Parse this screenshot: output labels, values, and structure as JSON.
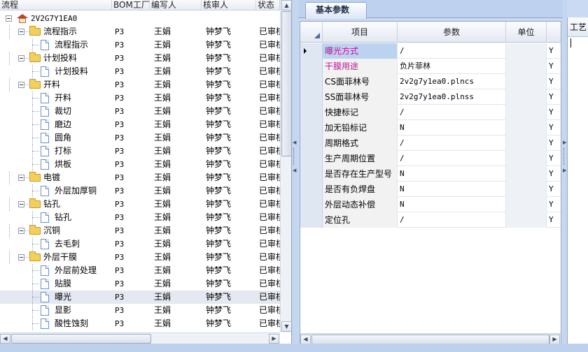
{
  "tree": {
    "columns": [
      "流程",
      "BOM工厂",
      "编写人",
      "核审人",
      "状态"
    ],
    "rows": [
      {
        "label": "2V2G7Y1EA0",
        "bom": "",
        "editor": "",
        "reviewer": "",
        "status": "",
        "level": 0,
        "icon": "house-icon"
      },
      {
        "label": "流程指示",
        "bom": "P3",
        "editor": "王娟",
        "reviewer": "钟梦飞",
        "status": "已审核",
        "level": 1,
        "icon": "folder-icon"
      },
      {
        "label": "流程指示",
        "bom": "P3",
        "editor": "王娟",
        "reviewer": "钟梦飞",
        "status": "已审核",
        "level": 2,
        "icon": "document-icon"
      },
      {
        "label": "计划投料",
        "bom": "P3",
        "editor": "王娟",
        "reviewer": "钟梦飞",
        "status": "已审核",
        "level": 1,
        "icon": "folder-icon"
      },
      {
        "label": "计划投料",
        "bom": "P3",
        "editor": "王娟",
        "reviewer": "钟梦飞",
        "status": "已审核",
        "level": 2,
        "icon": "document-icon"
      },
      {
        "label": "开料",
        "bom": "P3",
        "editor": "王娟",
        "reviewer": "钟梦飞",
        "status": "已审核",
        "level": 1,
        "icon": "folder-icon"
      },
      {
        "label": "开料",
        "bom": "P3",
        "editor": "王娟",
        "reviewer": "钟梦飞",
        "status": "已审核",
        "level": 2,
        "icon": "document-icon"
      },
      {
        "label": "裁切",
        "bom": "P3",
        "editor": "王娟",
        "reviewer": "钟梦飞",
        "status": "已审核",
        "level": 2,
        "icon": "document-icon"
      },
      {
        "label": "磨边",
        "bom": "P3",
        "editor": "王娟",
        "reviewer": "钟梦飞",
        "status": "已审核",
        "level": 2,
        "icon": "document-icon"
      },
      {
        "label": "圆角",
        "bom": "P3",
        "editor": "王娟",
        "reviewer": "钟梦飞",
        "status": "已审核",
        "level": 2,
        "icon": "document-icon"
      },
      {
        "label": "打标",
        "bom": "P3",
        "editor": "王娟",
        "reviewer": "钟梦飞",
        "status": "已审核",
        "level": 2,
        "icon": "document-icon"
      },
      {
        "label": "烘板",
        "bom": "P3",
        "editor": "王娟",
        "reviewer": "钟梦飞",
        "status": "已审核",
        "level": 2,
        "icon": "document-icon"
      },
      {
        "label": "电镀",
        "bom": "P3",
        "editor": "王娟",
        "reviewer": "钟梦飞",
        "status": "已审核",
        "level": 1,
        "icon": "folder-icon"
      },
      {
        "label": "外层加厚铜",
        "bom": "P3",
        "editor": "王娟",
        "reviewer": "钟梦飞",
        "status": "已审核",
        "level": 2,
        "icon": "document-icon"
      },
      {
        "label": "钻孔",
        "bom": "P3",
        "editor": "王娟",
        "reviewer": "钟梦飞",
        "status": "已审核",
        "level": 1,
        "icon": "folder-icon"
      },
      {
        "label": "钻孔",
        "bom": "P3",
        "editor": "王娟",
        "reviewer": "钟梦飞",
        "status": "已审核",
        "level": 2,
        "icon": "document-icon"
      },
      {
        "label": "沉铜",
        "bom": "P3",
        "editor": "王娟",
        "reviewer": "钟梦飞",
        "status": "已审核",
        "level": 1,
        "icon": "folder-icon"
      },
      {
        "label": "去毛刺",
        "bom": "P3",
        "editor": "王娟",
        "reviewer": "钟梦飞",
        "status": "已审核",
        "level": 2,
        "icon": "document-icon"
      },
      {
        "label": "外层干膜",
        "bom": "P3",
        "editor": "王娟",
        "reviewer": "钟梦飞",
        "status": "已审核",
        "level": 1,
        "icon": "folder-icon"
      },
      {
        "label": "外层前处理",
        "bom": "P3",
        "editor": "王娟",
        "reviewer": "钟梦飞",
        "status": "已审核",
        "level": 2,
        "icon": "document-icon"
      },
      {
        "label": "贴膜",
        "bom": "P3",
        "editor": "王娟",
        "reviewer": "钟梦飞",
        "status": "已审核",
        "level": 2,
        "icon": "document-icon"
      },
      {
        "label": "曝光",
        "bom": "P3",
        "editor": "王娟",
        "reviewer": "钟梦飞",
        "status": "已审核",
        "level": 2,
        "icon": "document-icon",
        "selected": true
      },
      {
        "label": "显影",
        "bom": "P3",
        "editor": "王娟",
        "reviewer": "钟梦飞",
        "status": "已审核",
        "level": 2,
        "icon": "document-icon"
      },
      {
        "label": "酸性蚀刻",
        "bom": "P3",
        "editor": "王娟",
        "reviewer": "钟梦飞",
        "status": "已审核",
        "level": 2,
        "icon": "document-icon"
      }
    ]
  },
  "tab": {
    "label": "基本参数"
  },
  "grid": {
    "columns": [
      "项目",
      "参数",
      "单位"
    ],
    "rows": [
      {
        "item": "曝光方式",
        "param": "/",
        "unit": "",
        "flag": "Y",
        "highlight": true,
        "item_color": "#c0109a",
        "current": true
      },
      {
        "item": "干膜用途",
        "param": "负片菲林",
        "unit": "",
        "flag": "Y",
        "item_color": "#c0109a"
      },
      {
        "item": "CS面菲林号",
        "param": "2v2g7y1ea0.plncs",
        "unit": "",
        "flag": "Y"
      },
      {
        "item": "SS面菲林号",
        "param": "2v2g7y1ea0.plnss",
        "unit": "",
        "flag": "Y"
      },
      {
        "item": "快捷标记",
        "param": "/",
        "unit": "",
        "flag": "Y"
      },
      {
        "item": "加无铅标记",
        "param": "N",
        "unit": "",
        "flag": "Y"
      },
      {
        "item": "周期格式",
        "param": "/",
        "unit": "",
        "flag": "Y"
      },
      {
        "item": "生产周期位置",
        "param": "/",
        "unit": "",
        "flag": "Y"
      },
      {
        "item": "是否存在生产型号",
        "param": "N",
        "unit": "",
        "flag": "Y"
      },
      {
        "item": "是否有负焊盘",
        "param": "N",
        "unit": "",
        "flag": "Y"
      },
      {
        "item": "外层动态补偿",
        "param": "N",
        "unit": "",
        "flag": "Y"
      },
      {
        "item": "定位孔",
        "param": "/",
        "unit": "",
        "flag": "Y"
      }
    ]
  },
  "side": {
    "header": "工艺"
  }
}
